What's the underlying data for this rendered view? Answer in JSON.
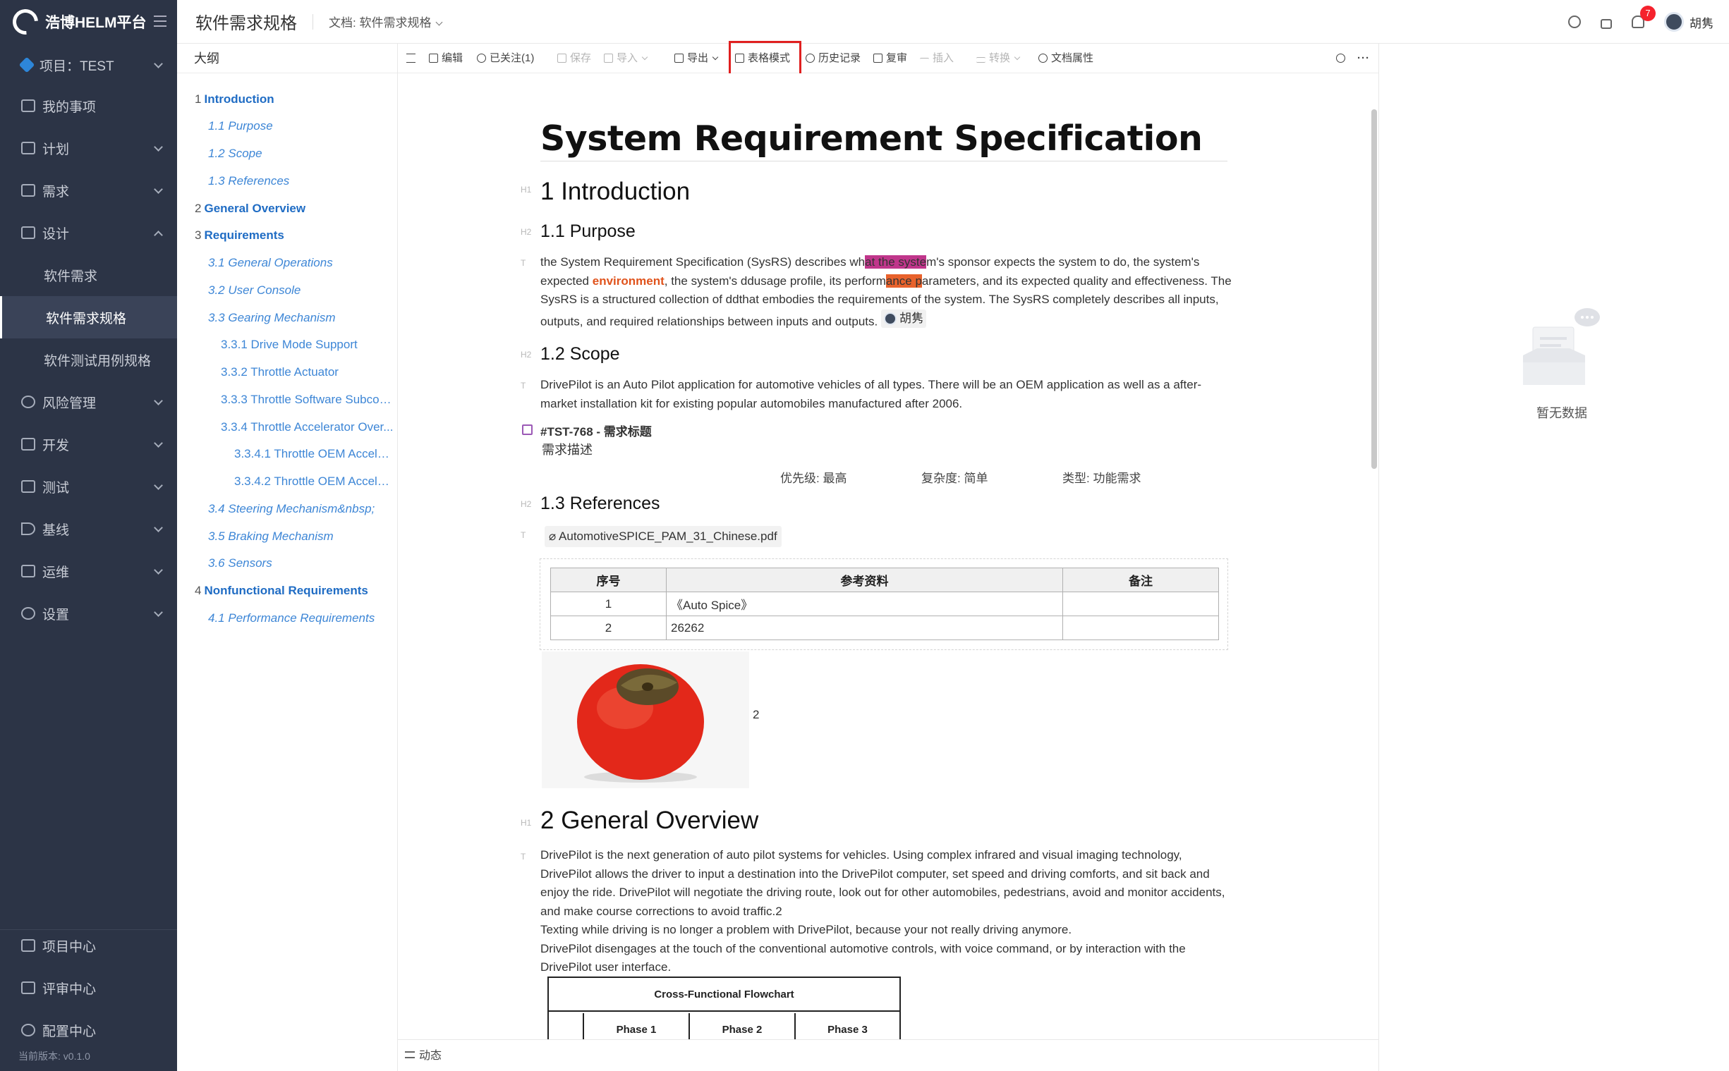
{
  "app": {
    "name": "浩博HELM平台",
    "version": "当前版本: v0.1.0"
  },
  "sidebar": {
    "project": "项目：TEST",
    "items": [
      {
        "label": "我的事项"
      },
      {
        "label": "计划"
      },
      {
        "label": "需求"
      },
      {
        "label": "设计"
      },
      {
        "label": "软件需求"
      },
      {
        "label": "软件需求规格"
      },
      {
        "label": "软件测试用例规格"
      },
      {
        "label": "风险管理"
      },
      {
        "label": "开发"
      },
      {
        "label": "测试"
      },
      {
        "label": "基线"
      },
      {
        "label": "运维"
      },
      {
        "label": "设置"
      }
    ],
    "bottom": [
      {
        "label": "项目中心"
      },
      {
        "label": "评审中心"
      },
      {
        "label": "配置中心"
      }
    ]
  },
  "header": {
    "title": "软件需求规格",
    "doc_label": "文档: 软件需求规格",
    "notifications": "7",
    "user": "胡隽"
  },
  "outline": {
    "title": "大纲",
    "items": [
      {
        "num": "1",
        "text": "Introduction"
      },
      {
        "text": "1.1 Purpose"
      },
      {
        "text": "1.2 Scope"
      },
      {
        "text": "1.3 References"
      },
      {
        "num": "2",
        "text": "General Overview"
      },
      {
        "num": "3",
        "text": "Requirements"
      },
      {
        "text": "3.1 General Operations"
      },
      {
        "text": "3.2 User Console"
      },
      {
        "text": "3.3 Gearing Mechanism"
      },
      {
        "text": "3.3.1 Drive Mode Support"
      },
      {
        "text": "3.3.2 Throttle Actuator"
      },
      {
        "text": "3.3.3 Throttle Software Subcon..."
      },
      {
        "text": "3.3.4 Throttle Accelerator Over..."
      },
      {
        "text": "3.3.4.1 Throttle OEM Acceler..."
      },
      {
        "text": "3.3.4.2 Throttle OEM Acceler..."
      },
      {
        "text": "3.4 Steering Mechanism&nbsp;"
      },
      {
        "text": "3.5 Braking Mechanism"
      },
      {
        "text": "3.6 Sensors"
      },
      {
        "num": "4",
        "text": "Nonfunctional Requirements"
      },
      {
        "text": "4.1 Performance Requirements"
      }
    ]
  },
  "toolbar": {
    "edit": "编辑",
    "followed": "已关注(1)",
    "save": "保存",
    "import": "导入",
    "export": "导出",
    "table_mode": "表格模式",
    "history": "历史记录",
    "review": "复审",
    "insert": "插入",
    "convert": "转换",
    "doc_props": "文档属性"
  },
  "document": {
    "title": "System Requirement Specification",
    "h_intro": "1 Introduction",
    "h_purpose": "1.1 Purpose",
    "purpose": {
      "t1": "the System Requirement Specification (SysRS) describes wh",
      "t2": "at the syste",
      "t3": "m's sponsor expects the system to do, the system's expected ",
      "t4": "environment",
      "t5": ", the system's ddusage profile, its perform",
      "t6": "ance p",
      "t7": "arameters, and its expected quality and effectiveness. The SysRS is a structured collection of ddthat embodies the requirements of the system. The SysRS completely describes all inputs, outputs, and required relationships between inputs and outputs.",
      "mention": "胡隽"
    },
    "h_scope": "1.2 Scope",
    "scope": "DrivePilot is an Auto Pilot application for automotive vehicles of all types. There will be an OEM application as well as a after-market installation kit for existing popular automobiles manufactured after 2006.",
    "req": {
      "id": "#TST-768 -   需求标题",
      "desc": "需求描述",
      "priority": "优先级: 最高",
      "complexity": "复杂度: 简单",
      "type": "类型: 功能需求"
    },
    "h_refs": "1.3 References",
    "attachment": "AutomotiveSPICE_PAM_31_Chinese.pdf",
    "ref_table": {
      "headers": [
        "序号",
        "参考资料",
        "备注"
      ],
      "rows": [
        [
          "1",
          "《Auto Spice》",
          ""
        ],
        [
          "2",
          "26262",
          ""
        ]
      ]
    },
    "image_caption": "2",
    "h_general": "2 General Overview",
    "general": {
      "p1": "DrivePilot is the next generation of auto pilot systems for vehicles. Using complex infrared and visual imaging technology, DrivePilot allows the driver to input a destination into the DrivePilot computer, set speed and driving comforts, and sit back and enjoy the ride. DrivePilot will negotiate the driving route, look out for other automobiles, pedestrians, avoid and monitor accidents, and make course corrections to avoid traffic.2",
      "p2": "Texting while driving is no longer a problem with DrivePilot, because your not really driving anymore.",
      "p3": "DrivePilot disengages at the touch of the conventional automotive controls, with voice command, or by interaction with the DrivePilot user interface."
    },
    "flowchart": {
      "title": "Cross-Functional Flowchart",
      "phases": [
        "Phase 1",
        "Phase 2",
        "Phase 3"
      ]
    },
    "markers": {
      "h1": "H1",
      "h2": "H2",
      "t": "T"
    }
  },
  "bottombar": {
    "activity": "动态"
  },
  "rightpanel": {
    "empty": "暂无数据"
  },
  "colors": {
    "sidebar_bg": "#2c3446",
    "link": "#1f6cc4",
    "highlight_pink": "#c0368b",
    "highlight_orange": "#e8622c",
    "badge": "#f5222d"
  }
}
